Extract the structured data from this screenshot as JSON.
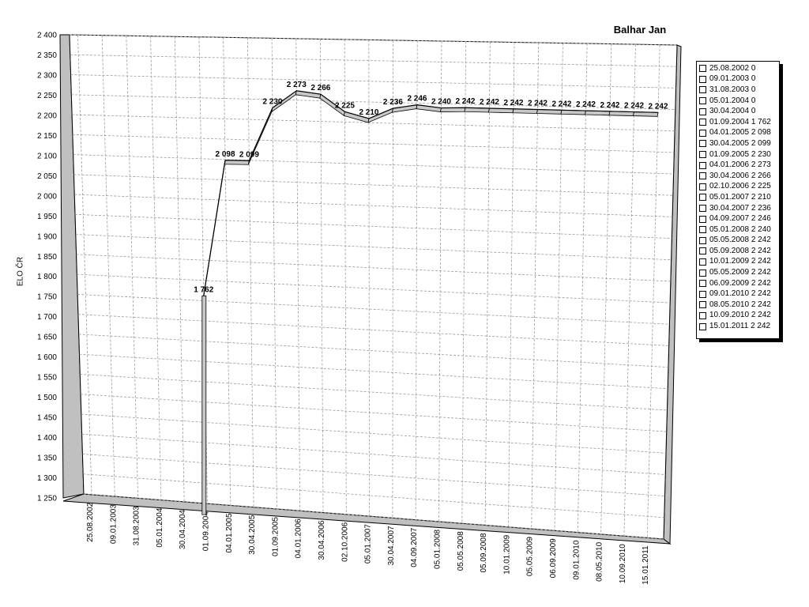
{
  "chart_data": {
    "type": "line",
    "title": "Balhar Jan",
    "xlabel": "",
    "ylabel": "ELO ČR",
    "ylim": [
      1250,
      2400
    ],
    "yticks": [
      1250,
      1300,
      1350,
      1400,
      1450,
      1500,
      1550,
      1600,
      1650,
      1700,
      1750,
      1800,
      1850,
      1900,
      1950,
      2000,
      2050,
      2100,
      2150,
      2200,
      2250,
      2300,
      2350,
      2400
    ],
    "ytick_labels": [
      "1 250",
      "1 300",
      "1 350",
      "1 400",
      "1 450",
      "1 500",
      "1 550",
      "1 600",
      "1 650",
      "1 700",
      "1 750",
      "1 800",
      "1 850",
      "1 900",
      "1 950",
      "2 000",
      "2 050",
      "2 100",
      "2 150",
      "2 200",
      "2 250",
      "2 300",
      "2 350",
      "2 400"
    ],
    "grid": true,
    "legend_position": "right",
    "view": "3d-perspective",
    "categories": [
      "25.08.2002",
      "09.01.2003",
      "31.08.2003",
      "05.01.2004",
      "30.04.2004",
      "01.09.2004",
      "04.01.2005",
      "30.04.2005",
      "01.09.2005",
      "04.01.2006",
      "30.04.2006",
      "02.10.2006",
      "05.01.2007",
      "30.04.2007",
      "04.09.2007",
      "05.01.2008",
      "05.05.2008",
      "05.09.2008",
      "10.01.2009",
      "05.05.2009",
      "06.09.2009",
      "09.01.2010",
      "08.05.2010",
      "10.09.2010",
      "15.01.2011"
    ],
    "values": [
      0,
      0,
      0,
      0,
      0,
      1762,
      2098,
      2099,
      2230,
      2273,
      2266,
      2225,
      2210,
      2236,
      2246,
      2240,
      2242,
      2242,
      2242,
      2242,
      2242,
      2242,
      2242,
      2242,
      2242
    ],
    "value_labels": [
      "",
      "",
      "",
      "",
      "",
      "1 762",
      "2 098",
      "2 099",
      "2 230",
      "2 273",
      "2 266",
      "2 225",
      "2 210",
      "2 236",
      "2 246",
      "2 240",
      "2 242",
      "2 242",
      "2 242",
      "2 242",
      "2 242",
      "2 242",
      "2 242",
      "2 242",
      "2 242"
    ],
    "legend_entries": [
      "25.08.2002 0",
      "09.01.2003 0",
      "31.08.2003 0",
      "05.01.2004 0",
      "30.04.2004 0",
      "01.09.2004 1 762",
      "04.01.2005 2 098",
      "30.04.2005 2 099",
      "01.09.2005 2 230",
      "04.01.2006 2 273",
      "30.04.2006 2 266",
      "02.10.2006 2 225",
      "05.01.2007 2 210",
      "30.04.2007 2 236",
      "04.09.2007 2 246",
      "05.01.2008 2 240",
      "05.05.2008 2 242",
      "05.09.2008 2 242",
      "10.01.2009 2 242",
      "05.05.2009 2 242",
      "06.09.2009 2 242",
      "09.01.2010 2 242",
      "08.05.2010 2 242",
      "10.09.2010 2 242",
      "15.01.2011 2 242"
    ],
    "colors": {
      "line": "#000000",
      "ribbon_top": "#ffffff",
      "ribbon_side": "#c8c8c8",
      "grid": "#9a9a9a",
      "wall_side": "#c0c0c0"
    }
  }
}
